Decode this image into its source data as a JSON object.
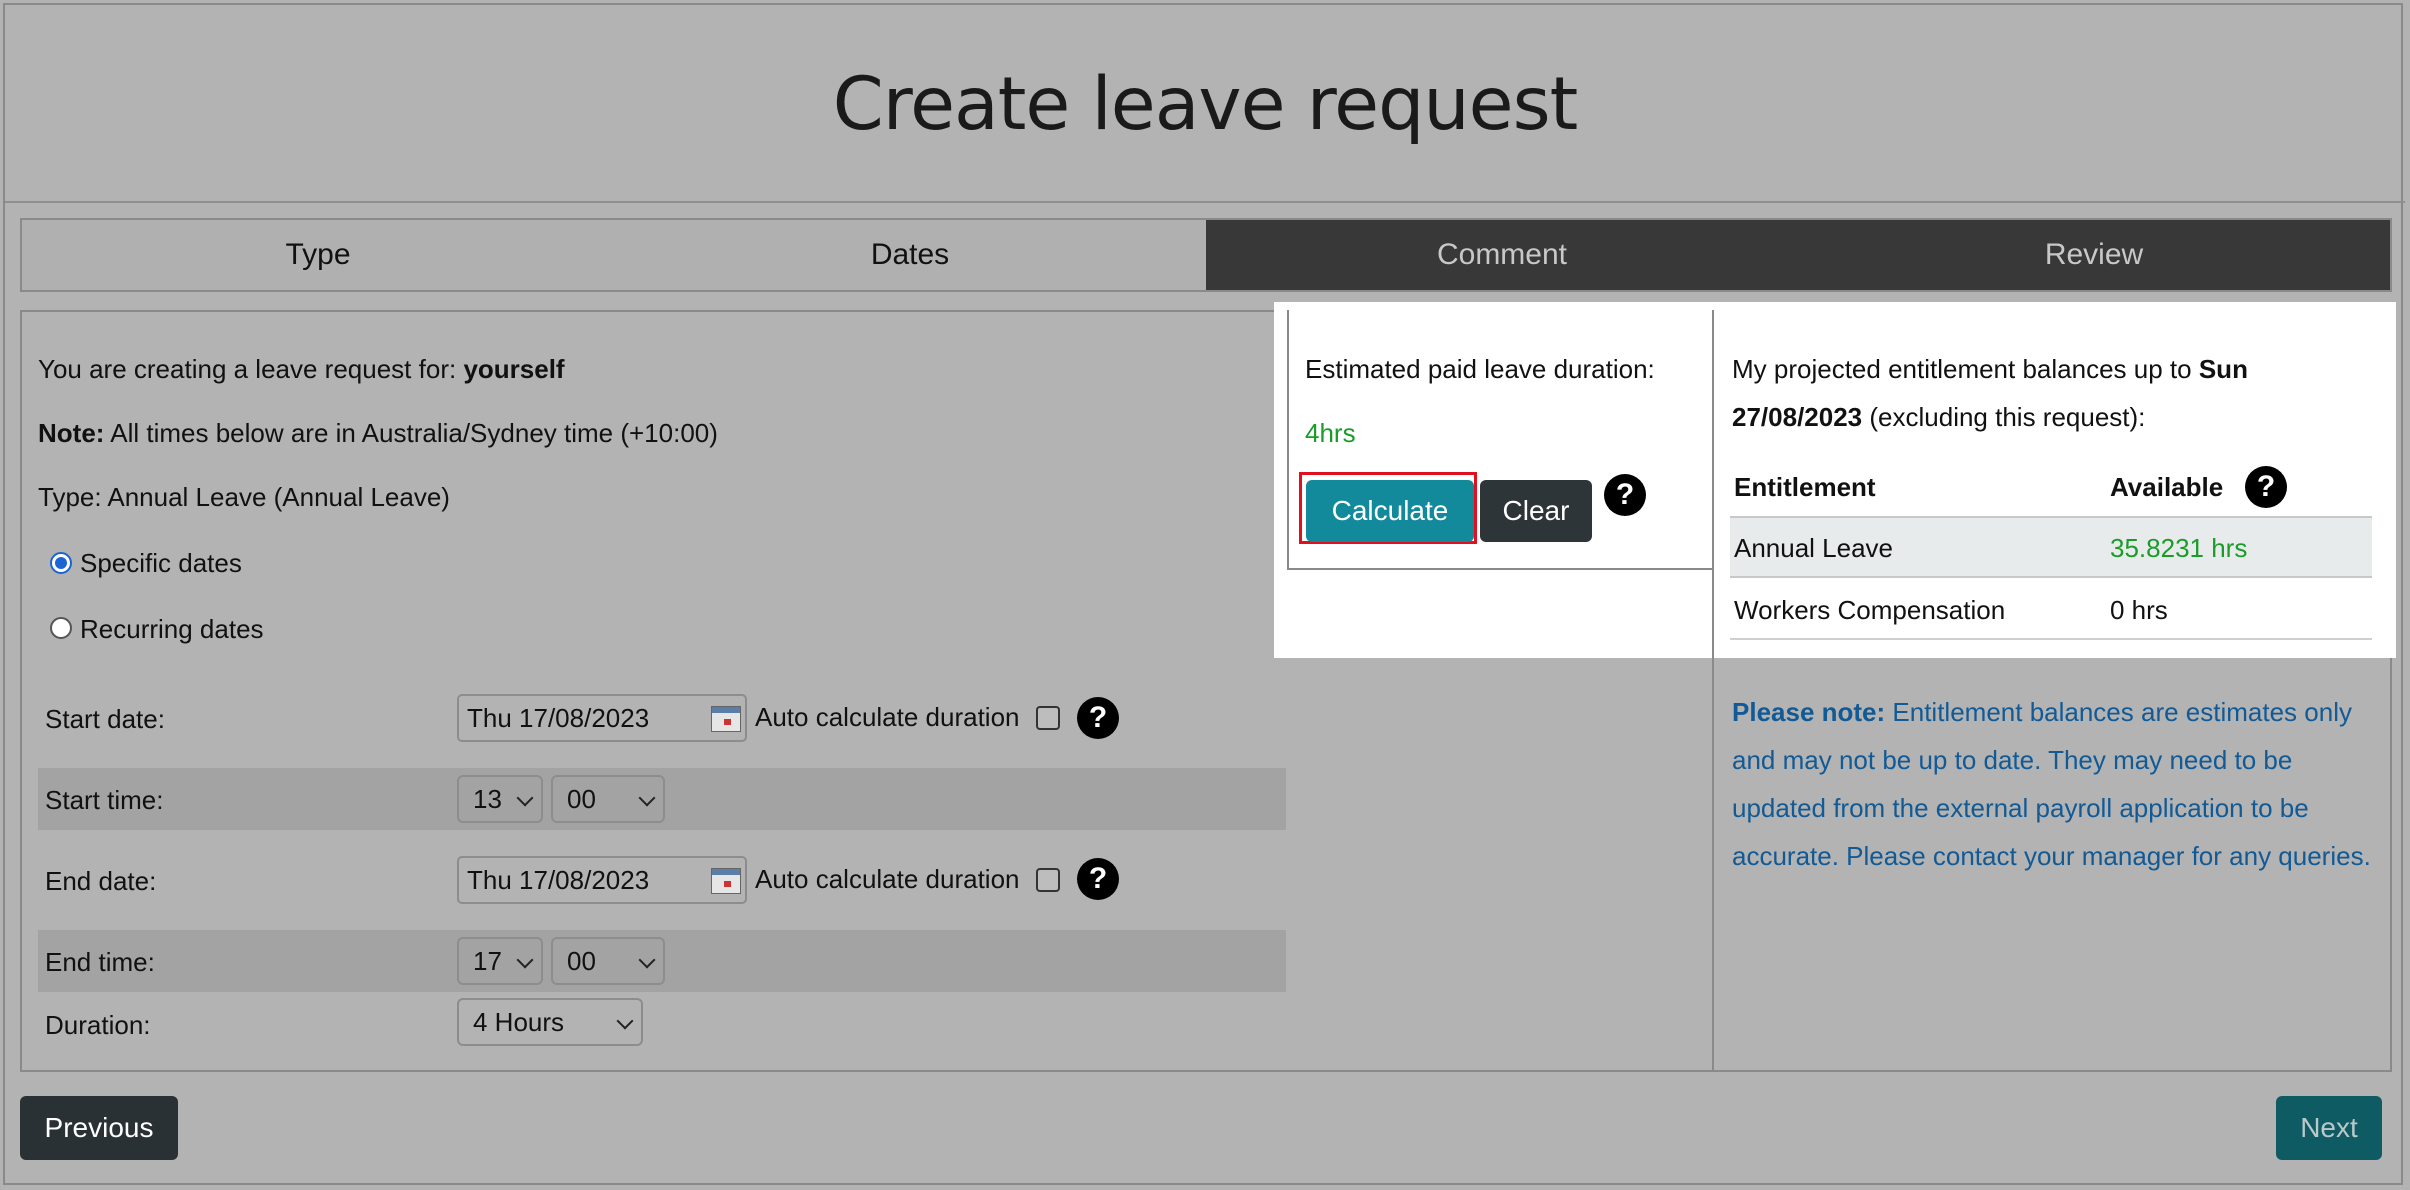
{
  "page": {
    "title": "Create leave request"
  },
  "steps": [
    {
      "label": "Type"
    },
    {
      "label": "Dates"
    },
    {
      "label": "Comment"
    },
    {
      "label": "Review"
    }
  ],
  "form": {
    "creating_for_prefix": "You are creating a leave request for:",
    "creating_for_value": "yourself",
    "note_label": "Note:",
    "note_text": "All times below are in Australia/Sydney time (+10:00)",
    "type_text": "Type: Annual Leave (Annual Leave)",
    "radio_specific": "Specific dates",
    "radio_recurring": "Recurring dates",
    "start_date_label": "Start date:",
    "start_date_value": "Thu 17/08/2023",
    "auto_calc_label": "Auto calculate duration",
    "start_time_label": "Start time:",
    "start_hour": "13",
    "start_min": "00",
    "end_date_label": "End date:",
    "end_date_value": "Thu 17/08/2023",
    "end_time_label": "End time:",
    "end_hour": "17",
    "end_min": "00",
    "duration_label": "Duration:",
    "duration_value": "4 Hours"
  },
  "estimate": {
    "label": "Estimated paid leave duration:",
    "value": "4hrs",
    "calculate": "Calculate",
    "clear": "Clear",
    "help": "?"
  },
  "balances": {
    "intro_prefix": "My projected entitlement balances up to",
    "intro_date_day": "Sun",
    "intro_date": "27/08/2023",
    "intro_suffix": "(excluding this request):",
    "col_entitlement": "Entitlement",
    "col_available": "Available",
    "rows": [
      {
        "name": "Annual Leave",
        "available": "35.8231 hrs"
      },
      {
        "name": "Workers Compensation",
        "available": "0 hrs"
      }
    ],
    "note_label": "Please note:",
    "note_text": "Entitlement balances are estimates only and may not be up to date. They may need to be updated from the external payroll application to be accurate. Please contact your manager for any queries."
  },
  "nav": {
    "previous": "Previous",
    "next": "Next"
  },
  "colors": {
    "accent": "#128a9c",
    "green": "#1b9c2a",
    "note_blue": "#115a96",
    "highlight": "#e0101e"
  }
}
